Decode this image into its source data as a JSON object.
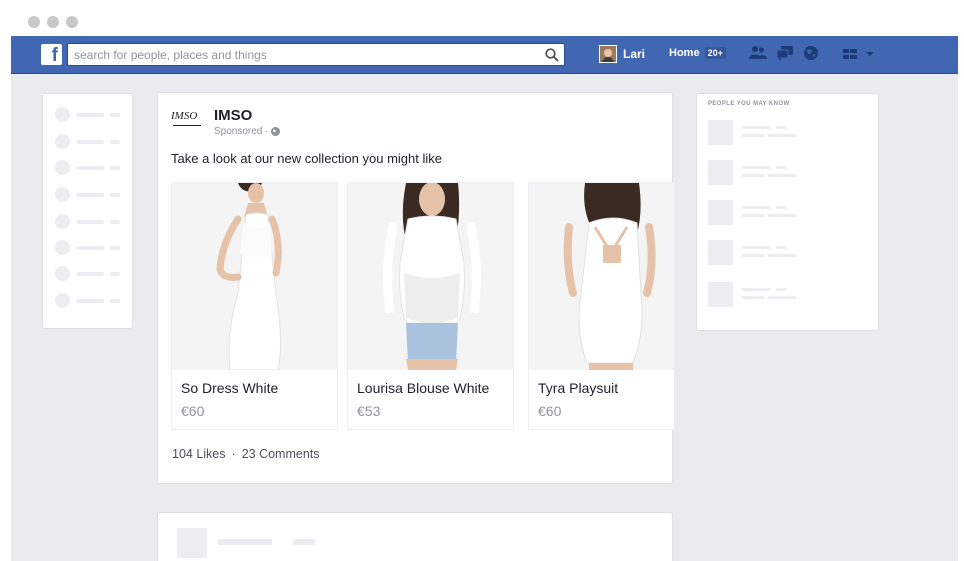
{
  "topbar": {
    "logo": "f",
    "search_placeholder": "search for people, places and things",
    "user_name": "Lari",
    "home_label": "Home",
    "home_badge": "20+"
  },
  "post": {
    "brand_logo_text": "IMSO",
    "brand_name": "IMSO",
    "sponsored": "Sponsored ·",
    "text": "Take a look at our new collection you might like",
    "products": [
      {
        "title": "So Dress White",
        "price": "€60"
      },
      {
        "title": "Lourisa Blouse White",
        "price": "€53"
      },
      {
        "title": "Tyra Playsuit",
        "price": "€60"
      }
    ],
    "likes": "104 Likes",
    "separator": "·",
    "comments": "23 Comments"
  },
  "right_panel": {
    "title": "PEOPLE YOU MAY KNOW"
  },
  "colors": {
    "brand_blue": "#4267b2",
    "page_bg": "#e9ebee"
  }
}
